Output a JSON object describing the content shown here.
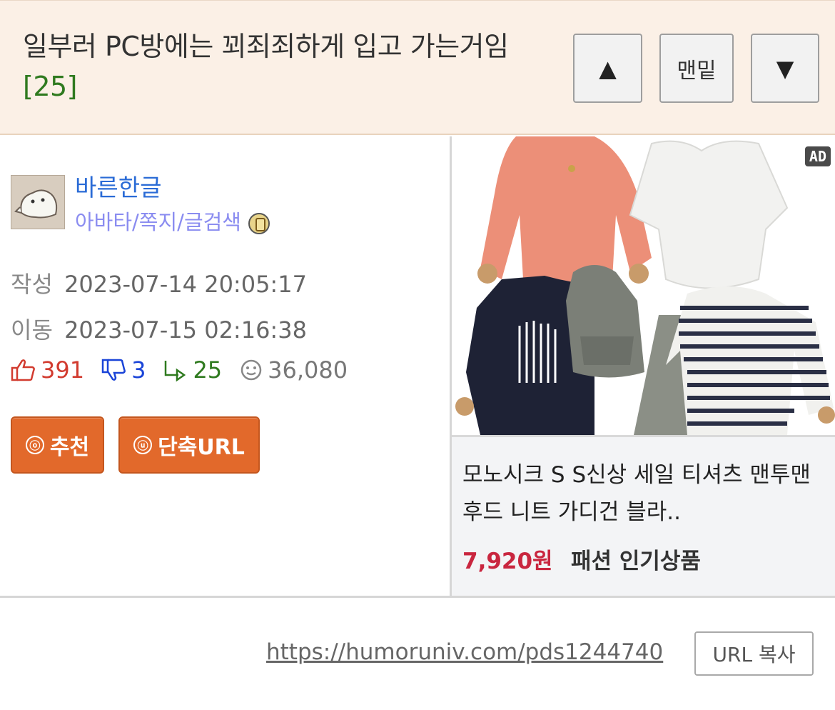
{
  "post": {
    "title": "일부러 PC방에는 꾀죄죄하게 입고 가는거임",
    "comment_count": "[25]"
  },
  "nav": {
    "up_label": "▲",
    "bottom_label": "맨밑",
    "down_label": "▼"
  },
  "author": {
    "name": "바른한글",
    "links": "아바타/쪽지/글검색"
  },
  "meta": {
    "created_label": "작성",
    "created_value": "2023-07-14 20:05:17",
    "moved_label": "이동",
    "moved_value": "2023-07-15 02:16:38"
  },
  "stats": {
    "likes": "391",
    "dislikes": "3",
    "replies": "25",
    "views": "36,080"
  },
  "actions": {
    "recommend_icon": "ⓞ",
    "recommend_label": "추천",
    "shorturl_icon": "ⓤ",
    "shorturl_label": "단축URL"
  },
  "ad": {
    "badge": "AD",
    "title": "모노시크 S S신상 세일 티셔츠 맨투맨 후드 니트 가디건 블라..",
    "price": "7,920원",
    "category": "패션 인기상품"
  },
  "footer": {
    "url": "https://humoruniv.com/pds1244740",
    "copy_label": "URL 복사"
  },
  "colors": {
    "title_bg": "#fbf0e6",
    "accent_orange": "#e2692b",
    "author_blue": "#2a6bd6",
    "like_red": "#d23b2f",
    "dislike_blue": "#1a44d8",
    "reply_green": "#2f7a1f",
    "price_red": "#c9263f"
  }
}
